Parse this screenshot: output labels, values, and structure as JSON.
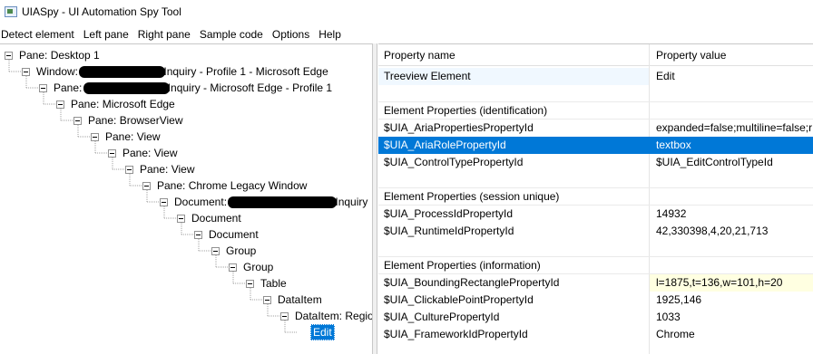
{
  "window": {
    "title": "UIASpy - UI Automation Spy Tool",
    "icon": "app-window-icon"
  },
  "menu": [
    {
      "label": "Detect element"
    },
    {
      "label": "Left pane"
    },
    {
      "label": "Right pane"
    },
    {
      "label": "Sample code"
    },
    {
      "label": "Options"
    },
    {
      "label": "Help"
    }
  ],
  "tree": {
    "nodes": [
      {
        "label": "Pane: Desktop 1",
        "expanded": true
      },
      {
        "label_pre": "Window: ",
        "label_post": "Inquiry - Profile 1 - Microsoft Edge",
        "redacted": true,
        "expanded": true
      },
      {
        "label_pre": "Pane: ",
        "label_post": "Inquiry - Microsoft Edge - Profile 1",
        "redacted": true,
        "expanded": true
      },
      {
        "label": "Pane: Microsoft Edge",
        "expanded": true
      },
      {
        "label": "Pane: BrowserView",
        "expanded": true
      },
      {
        "label": "Pane: View",
        "expanded": true
      },
      {
        "label": "Pane: View",
        "expanded": true
      },
      {
        "label": "Pane: View",
        "expanded": true
      },
      {
        "label": "Pane: Chrome Legacy Window",
        "expanded": true
      },
      {
        "label_pre": "Document: ",
        "label_post": "Inquiry",
        "redacted": true,
        "expanded": true
      },
      {
        "label": "Document",
        "expanded": true
      },
      {
        "label": "Document",
        "expanded": true
      },
      {
        "label": "Group",
        "expanded": true
      },
      {
        "label": "Group",
        "expanded": true
      },
      {
        "label": "Table",
        "expanded": true
      },
      {
        "label": "DataItem",
        "expanded": true
      },
      {
        "label": "DataItem: Region",
        "expanded": true
      },
      {
        "label": "Edit",
        "selected": true
      }
    ]
  },
  "properties": {
    "header": {
      "name": "Property name",
      "value": "Property value"
    },
    "rows": [
      {
        "name": "Treeview Element",
        "value": "Edit",
        "tint": true
      },
      {
        "name": "",
        "value": "",
        "gap": true
      },
      {
        "name": "Element Properties (identification)",
        "value": "",
        "section": true
      },
      {
        "name": "$UIA_AriaPropertiesPropertyId",
        "value": "expanded=false;multiline=false;r"
      },
      {
        "name": "$UIA_AriaRolePropertyId",
        "value": "textbox",
        "selected": true
      },
      {
        "name": "$UIA_ControlTypePropertyId",
        "value": "$UIA_EditControlTypeId"
      },
      {
        "name": "",
        "value": "",
        "gap": true
      },
      {
        "name": "Element Properties (session unique)",
        "value": "",
        "section": true
      },
      {
        "name": "$UIA_ProcessIdPropertyId",
        "value": "14932"
      },
      {
        "name": "$UIA_RuntimeIdPropertyId",
        "value": "42,330398,4,20,21,713"
      },
      {
        "name": "",
        "value": "",
        "gap": true
      },
      {
        "name": "Element Properties (information)",
        "value": "",
        "section": true
      },
      {
        "name": "$UIA_BoundingRectanglePropertyId",
        "value": "l=1875,t=136,w=101,h=20",
        "yellow": true
      },
      {
        "name": "$UIA_ClickablePointPropertyId",
        "value": "1925,146"
      },
      {
        "name": "$UIA_CulturePropertyId",
        "value": "1033"
      },
      {
        "name": "$UIA_FrameworkIdPropertyId",
        "value": "Chrome"
      }
    ]
  },
  "colors": {
    "selection": "#0078d7",
    "tint": "#f0f8ff",
    "highlight_yellow": "#ffffe1"
  }
}
